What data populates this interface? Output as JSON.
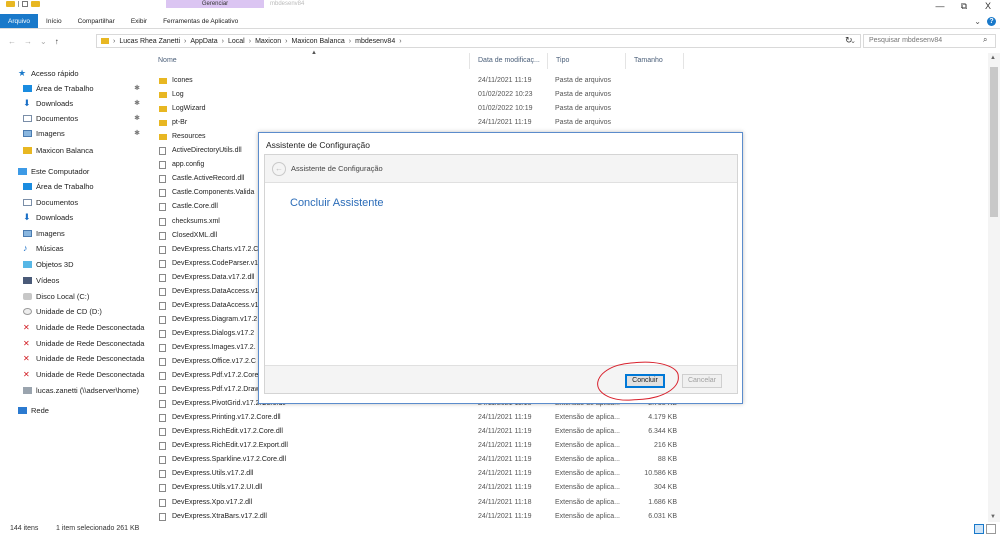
{
  "titlebar": {
    "context_tab": "Gerenciar",
    "title": "mbdesenv84",
    "minimize": "—",
    "maximize": "⧉",
    "close": "X"
  },
  "ribbon": {
    "tabs": [
      "Arquivo",
      "Início",
      "Compartilhar",
      "Exibir",
      "Ferramentas de Aplicativo"
    ],
    "active_tab": "Arquivo"
  },
  "address": {
    "crumbs": [
      "Lucas Rhea Zanetti",
      "AppData",
      "Local",
      "Maxicon",
      "Maxicon Balanca",
      "mbdesenv84"
    ],
    "search_placeholder": "Pesquisar mbdesenv84"
  },
  "sidebar": {
    "items": [
      {
        "label": "Acesso rápido",
        "icon": "star-icon",
        "pinned": false
      },
      {
        "label": "Área de Trabalho",
        "icon": "desktop-icon",
        "pinned": true
      },
      {
        "label": "Downloads",
        "icon": "download-icon",
        "pinned": true
      },
      {
        "label": "Documentos",
        "icon": "document-icon",
        "pinned": true
      },
      {
        "label": "Imagens",
        "icon": "image-icon",
        "pinned": true
      },
      {
        "label": "Maxicon Balanca",
        "icon": "folder-icon",
        "pinned": false
      },
      {
        "label": "Este Computador",
        "icon": "computer-icon",
        "pinned": false
      },
      {
        "label": "Área de Trabalho",
        "icon": "desktop-icon",
        "pinned": false
      },
      {
        "label": "Documentos",
        "icon": "document-icon",
        "pinned": false
      },
      {
        "label": "Downloads",
        "icon": "download-icon",
        "pinned": false
      },
      {
        "label": "Imagens",
        "icon": "image-icon",
        "pinned": false
      },
      {
        "label": "Músicas",
        "icon": "music-icon",
        "pinned": false
      },
      {
        "label": "Objetos 3D",
        "icon": "objects-3d-icon",
        "pinned": false
      },
      {
        "label": "Vídeos",
        "icon": "video-icon",
        "pinned": false
      },
      {
        "label": "Disco Local (C:)",
        "icon": "disk-icon",
        "pinned": false
      },
      {
        "label": "Unidade de CD (D:)",
        "icon": "cd-icon",
        "pinned": false
      },
      {
        "label": "Unidade de Rede Desconectada",
        "icon": "disconnected-network-drive-icon",
        "pinned": false
      },
      {
        "label": "Unidade de Rede Desconectada",
        "icon": "disconnected-network-drive-icon",
        "pinned": false
      },
      {
        "label": "Unidade de Rede Desconectada",
        "icon": "disconnected-network-drive-icon",
        "pinned": false
      },
      {
        "label": "Unidade de Rede Desconectada",
        "icon": "disconnected-network-drive-icon",
        "pinned": false
      },
      {
        "label": "lucas.zanetti (\\\\adserver\\home)",
        "icon": "network-drive-icon",
        "pinned": false
      },
      {
        "label": "Rede",
        "icon": "network-icon",
        "pinned": false
      }
    ]
  },
  "columns": {
    "name": "Nome",
    "date": "Data de modificaç...",
    "type": "Tipo",
    "size": "Tamanho"
  },
  "files": [
    {
      "name": "Icones",
      "date": "24/11/2021 11:19",
      "type": "Pasta de arquivos",
      "size": "",
      "kind": "folder"
    },
    {
      "name": "Log",
      "date": "01/02/2022 10:23",
      "type": "Pasta de arquivos",
      "size": "",
      "kind": "folder"
    },
    {
      "name": "LogWizard",
      "date": "01/02/2022 10:19",
      "type": "Pasta de arquivos",
      "size": "",
      "kind": "folder"
    },
    {
      "name": "pt-Br",
      "date": "24/11/2021 11:19",
      "type": "Pasta de arquivos",
      "size": "",
      "kind": "folder"
    },
    {
      "name": "Resources",
      "date": "",
      "type": "",
      "size": "",
      "kind": "folder"
    },
    {
      "name": "ActiveDirectoryUtils.dll",
      "date": "",
      "type": "",
      "size": "",
      "kind": "dll"
    },
    {
      "name": "app.config",
      "date": "",
      "type": "",
      "size": "",
      "kind": "dll"
    },
    {
      "name": "Castle.ActiveRecord.dll",
      "date": "",
      "type": "",
      "size": "",
      "kind": "dll"
    },
    {
      "name": "Castle.Components.Valida",
      "date": "",
      "type": "",
      "size": "",
      "kind": "dll"
    },
    {
      "name": "Castle.Core.dll",
      "date": "",
      "type": "",
      "size": "",
      "kind": "dll"
    },
    {
      "name": "checksums.xml",
      "date": "",
      "type": "",
      "size": "",
      "kind": "xml"
    },
    {
      "name": "ClosedXML.dll",
      "date": "",
      "type": "",
      "size": "",
      "kind": "dll"
    },
    {
      "name": "DevExpress.Charts.v17.2.C",
      "date": "",
      "type": "",
      "size": "",
      "kind": "dll"
    },
    {
      "name": "DevExpress.CodeParser.v1",
      "date": "",
      "type": "",
      "size": "",
      "kind": "dll"
    },
    {
      "name": "DevExpress.Data.v17.2.dll",
      "date": "",
      "type": "",
      "size": "",
      "kind": "dll"
    },
    {
      "name": "DevExpress.DataAccess.v1",
      "date": "",
      "type": "",
      "size": "",
      "kind": "dll"
    },
    {
      "name": "DevExpress.DataAccess.v1",
      "date": "",
      "type": "",
      "size": "",
      "kind": "dll"
    },
    {
      "name": "DevExpress.Diagram.v17.2",
      "date": "",
      "type": "",
      "size": "",
      "kind": "dll"
    },
    {
      "name": "DevExpress.Dialogs.v17.2",
      "date": "",
      "type": "",
      "size": "",
      "kind": "dll"
    },
    {
      "name": "DevExpress.Images.v17.2.",
      "date": "",
      "type": "",
      "size": "",
      "kind": "dll"
    },
    {
      "name": "DevExpress.Office.v17.2.C",
      "date": "",
      "type": "",
      "size": "",
      "kind": "dll"
    },
    {
      "name": "DevExpress.Pdf.v17.2.Core",
      "date": "",
      "type": "",
      "size": "",
      "kind": "dll"
    },
    {
      "name": "DevExpress.Pdf.v17.2.Draw",
      "date": "",
      "type": "",
      "size": "",
      "kind": "dll"
    },
    {
      "name": "DevExpress.PivotGrid.v17.2.Core.dll",
      "date": "24/11/2021 11:18",
      "type": "Extensão de aplica...",
      "size": "2.758 KB",
      "kind": "dll"
    },
    {
      "name": "DevExpress.Printing.v17.2.Core.dll",
      "date": "24/11/2021 11:19",
      "type": "Extensão de aplica...",
      "size": "4.179 KB",
      "kind": "dll"
    },
    {
      "name": "DevExpress.RichEdit.v17.2.Core.dll",
      "date": "24/11/2021 11:19",
      "type": "Extensão de aplica...",
      "size": "6.344 KB",
      "kind": "dll"
    },
    {
      "name": "DevExpress.RichEdit.v17.2.Export.dll",
      "date": "24/11/2021 11:19",
      "type": "Extensão de aplica...",
      "size": "216 KB",
      "kind": "dll"
    },
    {
      "name": "DevExpress.Sparkline.v17.2.Core.dll",
      "date": "24/11/2021 11:19",
      "type": "Extensão de aplica...",
      "size": "88 KB",
      "kind": "dll"
    },
    {
      "name": "DevExpress.Utils.v17.2.dll",
      "date": "24/11/2021 11:19",
      "type": "Extensão de aplica...",
      "size": "10.586 KB",
      "kind": "dll"
    },
    {
      "name": "DevExpress.Utils.v17.2.UI.dll",
      "date": "24/11/2021 11:19",
      "type": "Extensão de aplica...",
      "size": "304 KB",
      "kind": "dll"
    },
    {
      "name": "DevExpress.Xpo.v17.2.dll",
      "date": "24/11/2021 11:18",
      "type": "Extensão de aplica...",
      "size": "1.686 KB",
      "kind": "dll"
    },
    {
      "name": "DevExpress.XtraBars.v17.2.dll",
      "date": "24/11/2021 11:19",
      "type": "Extensão de aplica...",
      "size": "6.031 KB",
      "kind": "dll"
    }
  ],
  "status": {
    "items_count": "144 itens",
    "selection": "1 item selecionado  261 KB"
  },
  "dialog": {
    "title": "Assistente de Configuração",
    "header": "Assistente de Configuração",
    "heading": "Concluir Assistente",
    "primary_button": "Concluir",
    "secondary_button": "Cancelar"
  },
  "colors": {
    "accent": "#1979ca",
    "annotation_red": "#d8202c",
    "folder": "#e8b722"
  }
}
